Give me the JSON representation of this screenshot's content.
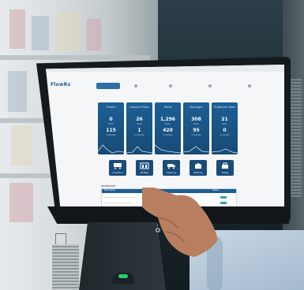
{
  "screen": {
    "app_logo": "FlowRx",
    "nav": [
      {
        "label": "",
        "active": true
      },
      {
        "label": "",
        "active": false
      },
      {
        "label": "",
        "active": false
      },
      {
        "label": "",
        "active": false
      },
      {
        "label": "",
        "active": false
      }
    ],
    "cards": [
      {
        "title": "Orders",
        "value1": "0",
        "sub1": "Open",
        "value2": "115",
        "sub2": "Complete"
      },
      {
        "title": "Inbound Totes",
        "value1": "26",
        "sub1": "Open",
        "value2": "1",
        "sub2": "Complete"
      },
      {
        "title": "Packs",
        "value1": "1,296",
        "sub1": "Open",
        "value2": "420",
        "sub2": "Complete"
      },
      {
        "title": "Packages",
        "value1": "308",
        "sub1": "Open",
        "value2": "95",
        "sub2": "Complete"
      },
      {
        "title": "Outbound Totes",
        "value1": "21",
        "sub1": "Open",
        "value2": "0",
        "sub2": "Complete"
      }
    ],
    "tiles": [
      {
        "label": "Induction",
        "icon": "conveyor-icon"
      },
      {
        "label": "Bottles",
        "icon": "bottles-icon"
      },
      {
        "label": "Clearing",
        "icon": "truck-icon"
      },
      {
        "label": "Packing",
        "icon": "box-icon"
      },
      {
        "label": "Toting",
        "icon": "tote-icon"
      }
    ],
    "table_title": "INTERFACES",
    "table_headers": [
      "Description",
      "Status"
    ]
  },
  "colors": {
    "card_blue": "#1d5f95",
    "tile_blue": "#1a4c79",
    "led_green": "#2ecf6b"
  }
}
